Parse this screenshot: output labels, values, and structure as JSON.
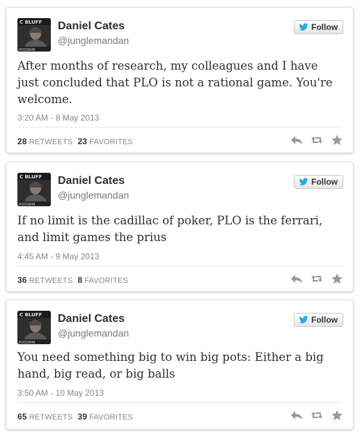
{
  "colors": {
    "card_border": "#dcdcdc",
    "icon_gray": "#999999",
    "twitter_blue": "#2aa9e0"
  },
  "tweets": [
    {
      "author": {
        "name": "Daniel Cates",
        "handle": "@junglemandan"
      },
      "follow_label": "Follow",
      "text": "After months of research, my colleagues and I have just concluded that PLO is not a rational game. You're welcome.",
      "timestamp": "3:20 AM - 8 May 2013",
      "retweets": "28",
      "retweets_label": "RETWEETS",
      "favorites": "23",
      "favorites_label": "FAVORITES",
      "actions": [
        "reply-icon",
        "retweet-icon",
        "favorite-star-icon"
      ]
    },
    {
      "author": {
        "name": "Daniel Cates",
        "handle": "@junglemandan"
      },
      "follow_label": "Follow",
      "text": "If no limit is the cadillac of poker, PLO is the ferrari, and limit games the prius",
      "timestamp": "4:45 AM - 9 May 2013",
      "retweets": "36",
      "retweets_label": "RETWEETS",
      "favorites": "8",
      "favorites_label": "FAVORITES",
      "actions": [
        "reply-icon",
        "retweet-icon",
        "favorite-star-icon"
      ]
    },
    {
      "author": {
        "name": "Daniel Cates",
        "handle": "@junglemandan"
      },
      "follow_label": "Follow",
      "text": "You need something big to win big pots: Either a big hand, big read, or big balls",
      "timestamp": "3:50 AM - 10 May 2013",
      "retweets": "65",
      "retweets_label": "RETWEETS",
      "favorites": "39",
      "favorites_label": "FAVORITES",
      "actions": [
        "reply-icon",
        "retweet-icon",
        "favorite-star-icon"
      ]
    }
  ]
}
